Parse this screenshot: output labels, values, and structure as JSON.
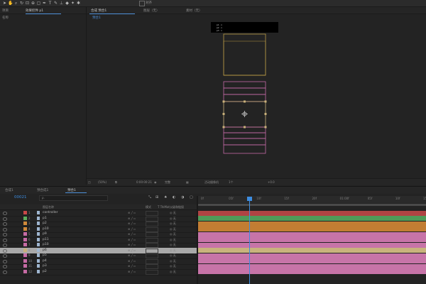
{
  "toolbar": {
    "tools": [
      "arrow-icon",
      "hand-icon",
      "zoom-icon",
      "rotate-icon",
      "camera-icon",
      "pan-behind-icon",
      "rect-icon",
      "pen-icon",
      "type-icon",
      "brush-icon",
      "stamp-icon",
      "eraser-icon",
      "roto-icon",
      "pin-icon"
    ],
    "snap_label": "对齐"
  },
  "project_panel": {
    "tab_project": "项目",
    "tab_effects": "效果控件 p1",
    "column_name": "名称"
  },
  "viewer": {
    "tab_comp": "合成 预合1",
    "tab_layer": "图层（无）",
    "tab_footage": "素材（无）",
    "breadcrumb": "预合1",
    "bottom_bar": {
      "zoom": "(50%)",
      "timecode": "0:00:00:21",
      "resolution": "完整",
      "camera": "活动摄像机",
      "views": "1个",
      "exposure": "+0.0"
    }
  },
  "timeline": {
    "tabs": [
      "合成1",
      "预合成1",
      "预合1"
    ],
    "active_tab": "预合1",
    "current_time": "00021",
    "search_placeholder": "ρ.",
    "headers": {
      "name": "图层名称",
      "mode": "模式",
      "trkmat": "T TrkMat",
      "parent": "父级和链接"
    },
    "ruler_labels": [
      "0f",
      "05f",
      "10f",
      "15f",
      "20f",
      "01:00f",
      "05f",
      "10f",
      "15f"
    ],
    "layers": [
      {
        "num": "1",
        "name": "controller",
        "color": "#c94848",
        "bar": "#b04343",
        "parent": "无"
      },
      {
        "num": "2",
        "name": "p1",
        "color": "#5dae5d",
        "bar": "#4f9a58",
        "parent": "无"
      },
      {
        "num": "3",
        "name": "p2",
        "color": "#d08a3a",
        "bar": "#c27d33",
        "parent": "无"
      },
      {
        "num": "4",
        "name": "p10",
        "color": "#d08a3a",
        "bar": "#c27d33",
        "parent": "无"
      },
      {
        "num": "5",
        "name": "p9",
        "color": "#c66aa4",
        "bar": "#c774a8",
        "parent": "无"
      },
      {
        "num": "6",
        "name": "p11",
        "color": "#c66aa4",
        "bar": "#c774a8",
        "parent": "无"
      },
      {
        "num": "7",
        "name": "p10",
        "color": "#c66aa4",
        "bar": "#c774a8",
        "parent": "无"
      },
      {
        "num": "8",
        "name": "p6",
        "color": "#c8b07a",
        "bar": "#c9b37d",
        "parent": "无",
        "selected": true
      },
      {
        "num": "9",
        "name": "p5",
        "color": "#c66aa4",
        "bar": "#c774a8",
        "parent": "无"
      },
      {
        "num": "10",
        "name": "p4",
        "color": "#c66aa4",
        "bar": "#c774a8",
        "parent": "无"
      },
      {
        "num": "11",
        "name": "p3",
        "color": "#c66aa4",
        "bar": "#c774a8",
        "parent": "无"
      },
      {
        "num": "12",
        "name": "p2",
        "color": "#c66aa4",
        "bar": "#c774a8",
        "parent": "无"
      }
    ],
    "playhead_fraction": 0.223
  },
  "composition": {
    "info_lines": [
      "p1 · x",
      "p2 · x",
      "p3 · x"
    ]
  },
  "colors": {
    "accent": "#3d8de0",
    "layer_outline_gold": "#b99a45",
    "layer_outline_pink": "#c36aa6"
  }
}
